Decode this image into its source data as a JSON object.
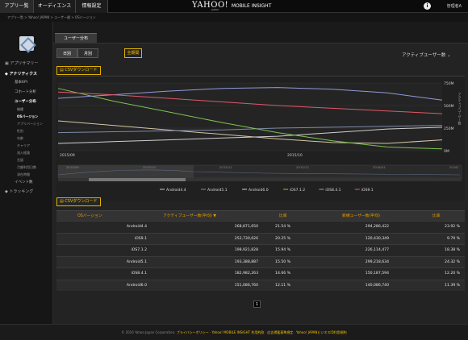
{
  "topbar": {
    "tabs": [
      "アプリ一覧",
      "オーディエンス",
      "情報設定"
    ],
    "brand": "YAHOO!",
    "brand_suffix": "MOBILE INSIGHT",
    "brand_sub": "JAPAN",
    "info_icon": "i",
    "user": "管理者A"
  },
  "breadcrumb": "アプリ一覧 > Yahoo! JAPAN > ユーザー層 > OSバージョン",
  "sidebar": {
    "items": [
      {
        "label": "▣ アプリサマリー"
      },
      {
        "label": "◆ アナリティクス"
      },
      {
        "label": "基本KPI"
      },
      {
        "label": "コホート分析"
      },
      {
        "label": "ユーザー分布"
      },
      {
        "label": "機種"
      },
      {
        "label": "OSバージョン"
      },
      {
        "label": "アプリバージョン"
      },
      {
        "label": "性別"
      },
      {
        "label": "年齢"
      },
      {
        "label": "キャリア"
      },
      {
        "label": "流入経路"
      },
      {
        "label": "言語"
      },
      {
        "label": "月額利用日数"
      },
      {
        "label": "滞在時間"
      },
      {
        "label": "イベント数"
      },
      {
        "label": "◆ トラッキング"
      }
    ]
  },
  "main": {
    "page_tab": "ユーザー分布",
    "segments": [
      "日別",
      "月別"
    ],
    "all_period": "全期間",
    "metric_select": "アクティブユーザー数 ⌄",
    "csv1": "▤ CSVダウンロード",
    "csv2": "▤ CSVダウンロード",
    "pager": "1"
  },
  "chart_data": {
    "type": "line",
    "x": [
      "2015/09",
      "2015/10"
    ],
    "y_ticks": [
      "750M",
      "500M",
      "250M",
      "0M"
    ],
    "ylim": [
      0,
      750
    ],
    "navigator_labels": [
      "2015/09",
      "2015/10",
      "2015/11",
      "2015/12",
      "2016/01",
      "2016/"
    ],
    "y_axis_label": "アクティブユーザー数",
    "series": [
      {
        "name": "Android4.4",
        "color": "#d4c7a6",
        "values": [
          330,
          280,
          230,
          180,
          130,
          90,
          80,
          120
        ]
      },
      {
        "name": "Android5.1",
        "color": "#7d8aa7",
        "values": [
          200,
          210,
          220,
          230,
          250,
          260,
          270,
          280
        ]
      },
      {
        "name": "Android6.0",
        "color": "#cfcfcf",
        "values": [
          80,
          100,
          120,
          140,
          160,
          200,
          240,
          260
        ]
      },
      {
        "name": "iOS7.1.2",
        "color": "#7ec34f",
        "values": [
          690,
          550,
          430,
          310,
          200,
          110,
          40,
          20
        ]
      },
      {
        "name": "iOS8.4.1",
        "color": "#8e9bd8",
        "values": [
          580,
          620,
          660,
          690,
          700,
          680,
          640,
          560
        ]
      },
      {
        "name": "iOS9.1",
        "color": "#e0586a",
        "values": [
          650,
          620,
          580,
          540,
          500,
          470,
          440,
          410
        ]
      }
    ]
  },
  "table": {
    "headers": [
      "OSバージョン",
      "アクティブユーザー数(平均) ▼",
      "比率",
      "新規ユーザー数(平均)",
      "比率"
    ],
    "rows": [
      [
        "Android4.4",
        "268,871,650",
        "21.54 %",
        "294,286,422",
        "23.92 %"
      ],
      [
        "iOS9.1",
        "252,730,626",
        "20.25 %",
        "120,430,349",
        "9.79 %"
      ],
      [
        "iOS7.1.2",
        "198,921,828",
        "15.94 %",
        "226,114,477",
        "18.38 %"
      ],
      [
        "Android5.1",
        "193,388,887",
        "15.50 %",
        "299,218,634",
        "24.32 %"
      ],
      [
        "iOS8.4.1",
        "182,982,263",
        "14.66 %",
        "150,187,594",
        "12.20 %"
      ],
      [
        "Android6.0",
        "151,086,760",
        "12.11 %",
        "140,086,740",
        "11.39 %"
      ]
    ]
  },
  "footer": {
    "copyright": "© 2016 Yahoo Japan Corporation.",
    "link1": "プライバシーポリシー",
    "link2": "Yahoo! MOBILE INSIGHT 利用約款",
    "link3": "広告掲載基準規定",
    "link4": "Yahoo! JAPANビジネスID利用規約"
  },
  "colors": {
    "accent": "#f0c000",
    "chart_bg": "#202020"
  }
}
